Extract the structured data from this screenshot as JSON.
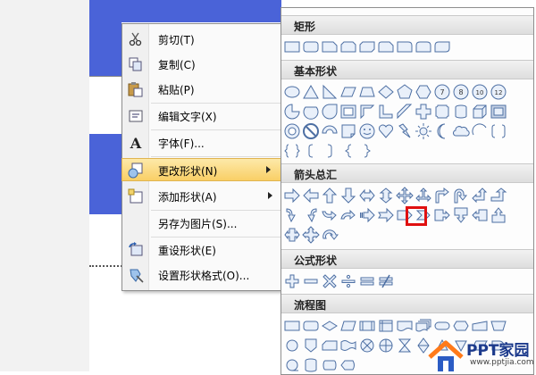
{
  "context_menu": {
    "items": [
      {
        "label": "剪切(T)",
        "icon": "scissors-icon"
      },
      {
        "label": "复制(C)",
        "icon": "copy-icon"
      },
      {
        "label": "粘贴(P)",
        "icon": "paste-icon"
      },
      {
        "label": "编辑文字(X)",
        "icon": "edit-text-icon"
      },
      {
        "label": "字体(F)...",
        "icon": "font-icon"
      },
      {
        "label": "更改形状(N)",
        "icon": "change-shape-icon",
        "highlighted": true,
        "submenu": true
      },
      {
        "label": "添加形状(A)",
        "icon": "add-shape-icon",
        "submenu": true
      },
      {
        "label": "另存为图片(S)...",
        "icon": ""
      },
      {
        "label": "重设形状(E)",
        "icon": "reset-shape-icon"
      },
      {
        "label": "设置形状格式(O)...",
        "icon": "format-shape-icon"
      }
    ]
  },
  "shapes_menu": {
    "sections": [
      {
        "title": "矩形"
      },
      {
        "title": "基本形状"
      },
      {
        "title": "箭头总汇"
      },
      {
        "title": "公式形状"
      },
      {
        "title": "流程图"
      }
    ],
    "basic_row1_numbers": [
      "7",
      "8",
      "10",
      "12"
    ]
  },
  "watermark": {
    "name": "PPT家园",
    "url": "www.pptjia.com"
  },
  "colors": {
    "accent_blue": "#4a63d8",
    "highlight": "#f9cf66",
    "selection_red": "#e01010"
  }
}
